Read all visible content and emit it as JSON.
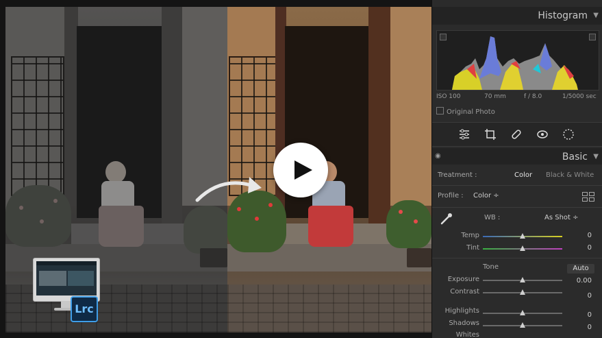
{
  "panel": {
    "histogram_title": "Histogram",
    "exif": {
      "iso": "ISO 100",
      "focal": "70 mm",
      "aperture": "f / 8.0",
      "shutter": "1/5000 sec"
    },
    "original_photo": "Original Photo",
    "basic_title": "Basic",
    "treatment": {
      "label": "Treatment :",
      "color": "Color",
      "bw": "Black & White"
    },
    "profile": {
      "label": "Profile :",
      "value": "Color ÷"
    },
    "wb": {
      "label": "WB :",
      "value": "As Shot ÷"
    },
    "temp": {
      "label": "Temp",
      "value": "0",
      "level": 0.5
    },
    "tint": {
      "label": "Tint",
      "value": "0",
      "level": 0.5
    },
    "tone": {
      "label": "Tone",
      "auto": "Auto"
    },
    "exposure": {
      "label": "Exposure",
      "value": "0.00",
      "level": 0.5
    },
    "contrast": {
      "label": "Contrast",
      "value": "0",
      "level": 0.5
    },
    "highlights": {
      "label": "Highlights",
      "value": "0",
      "level": 0.5
    },
    "shadows": {
      "label": "Shadows",
      "value": "0",
      "level": 0.5
    },
    "whites": {
      "label": "Whites"
    }
  },
  "badge": {
    "app": "Lrc"
  },
  "icons": {
    "play": "play-icon",
    "arrow": "curved-arrow-icon",
    "sliders": "sliders-icon",
    "crop": "crop-icon",
    "healing": "bandage-icon",
    "redeye": "eye-icon",
    "mask": "mask-icon",
    "eyedropper": "eyedropper-icon",
    "grid": "grid-icon"
  },
  "colors": {
    "accent_play": "#ffffff",
    "lrc_blue": "#3f9ee8"
  }
}
